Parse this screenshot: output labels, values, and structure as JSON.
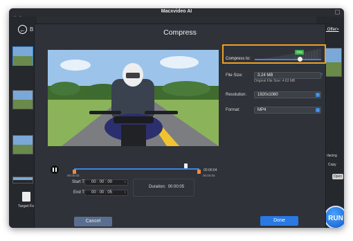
{
  "app": {
    "title": "Macxvideo AI"
  },
  "background": {
    "left_panel": {
      "b_label": "B",
      "target_label": "Target Fo"
    },
    "right_panel": {
      "holiday_link": "iday Offer>",
      "deinterlacing": "rlacing",
      "copy": "Copy",
      "open_button": "Open",
      "run_button": "RUN"
    }
  },
  "dialog": {
    "title": "Compress",
    "timeline": {
      "current_time": "00:00:04",
      "start_time_small": "00:00:00",
      "end_time_small": "00:00:05"
    },
    "start_time": {
      "label": "Start Time:",
      "value": "00 : 00 : 00"
    },
    "end_time": {
      "label": "End Time:",
      "value": "00 : 00 : 05"
    },
    "duration": {
      "label": "Duration:",
      "value": "00:00:05"
    },
    "compress": {
      "label": "Compress to:",
      "value": "70%",
      "level": 0.7
    },
    "file_size": {
      "label": "File Size:",
      "value": "3.24 MB",
      "original": "Original File Size: 4.63 MB"
    },
    "resolution": {
      "label": "Resolution:",
      "value": "1920x1080"
    },
    "format": {
      "label": "Format:",
      "value": "MP4"
    },
    "cancel": "Cancel",
    "done": "Done"
  },
  "colors": {
    "accent": "#2a78e4",
    "highlight": "#f0a020",
    "badge": "#36b24b"
  }
}
